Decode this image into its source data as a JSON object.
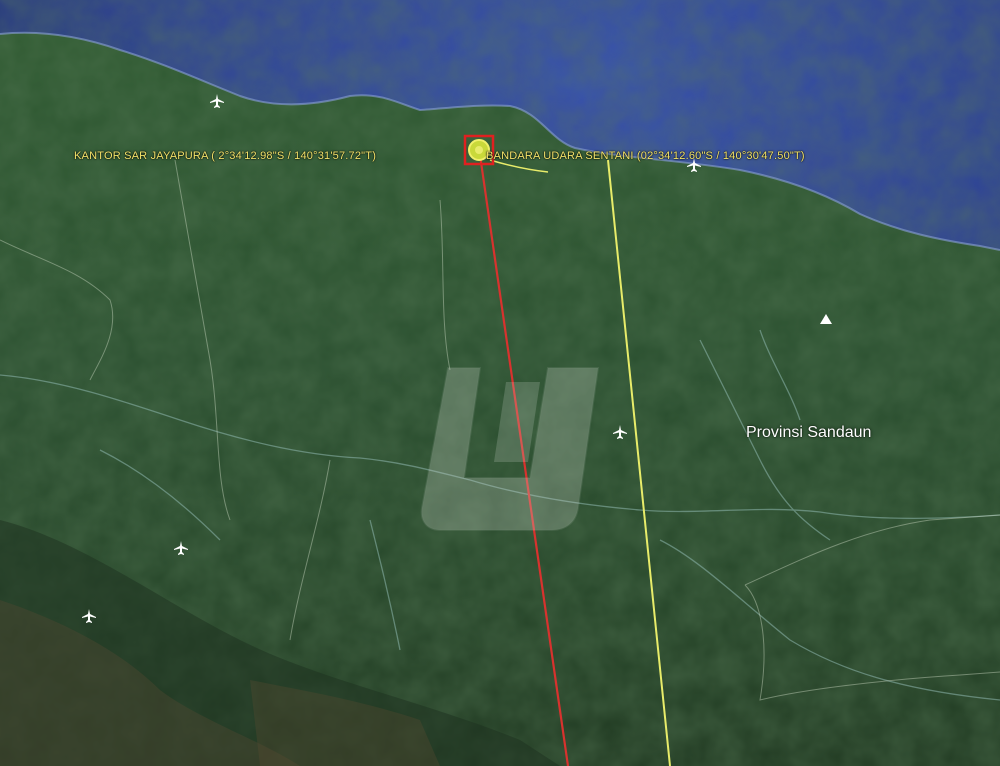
{
  "map": {
    "placemarks": [
      {
        "id": "kantor-sar",
        "label": "KANTOR SAR JAYAPURA (  2°34'12.98\"S / 140°31'57.72\"T)"
      },
      {
        "id": "bandara-sentani",
        "label": "BANDARA UDARA SENTANI (02°34'12.60\"S / 140°30'47.50\"T)"
      }
    ],
    "regions": [
      {
        "id": "sandaun",
        "label": "Provinsi Sandaun"
      }
    ],
    "colors": {
      "sea": "#2a3f9a",
      "land": "#2f5130",
      "bearing_line": "#d8322e",
      "border_line": "#e8ec6a",
      "placemark_text": "#f2e36a",
      "river": "#8fb8b0"
    },
    "icons": [
      "airport-icon",
      "target-marker-icon",
      "watermark-logo"
    ]
  }
}
